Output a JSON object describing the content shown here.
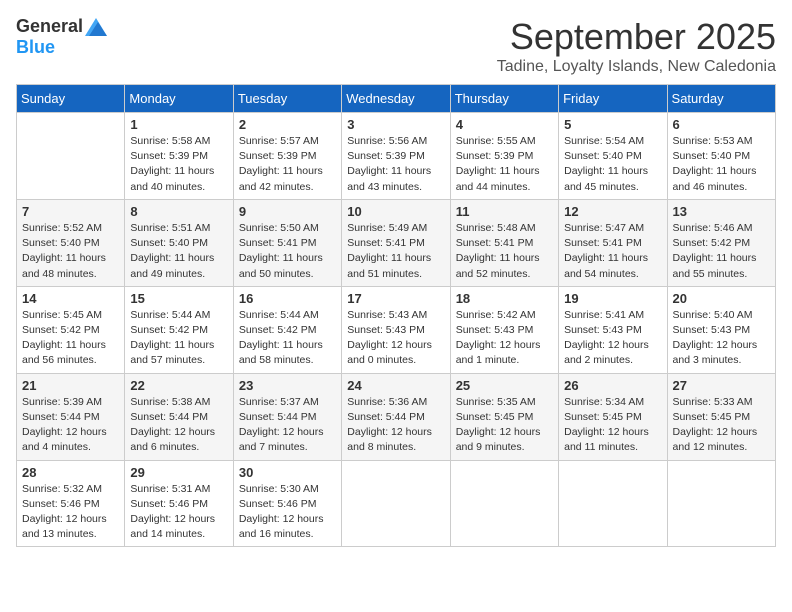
{
  "logo": {
    "general": "General",
    "blue": "Blue"
  },
  "header": {
    "month": "September 2025",
    "location": "Tadine, Loyalty Islands, New Caledonia"
  },
  "weekdays": [
    "Sunday",
    "Monday",
    "Tuesday",
    "Wednesday",
    "Thursday",
    "Friday",
    "Saturday"
  ],
  "weeks": [
    [
      {
        "day": "",
        "sunrise": "",
        "sunset": "",
        "daylight": ""
      },
      {
        "day": "1",
        "sunrise": "Sunrise: 5:58 AM",
        "sunset": "Sunset: 5:39 PM",
        "daylight": "Daylight: 11 hours and 40 minutes."
      },
      {
        "day": "2",
        "sunrise": "Sunrise: 5:57 AM",
        "sunset": "Sunset: 5:39 PM",
        "daylight": "Daylight: 11 hours and 42 minutes."
      },
      {
        "day": "3",
        "sunrise": "Sunrise: 5:56 AM",
        "sunset": "Sunset: 5:39 PM",
        "daylight": "Daylight: 11 hours and 43 minutes."
      },
      {
        "day": "4",
        "sunrise": "Sunrise: 5:55 AM",
        "sunset": "Sunset: 5:39 PM",
        "daylight": "Daylight: 11 hours and 44 minutes."
      },
      {
        "day": "5",
        "sunrise": "Sunrise: 5:54 AM",
        "sunset": "Sunset: 5:40 PM",
        "daylight": "Daylight: 11 hours and 45 minutes."
      },
      {
        "day": "6",
        "sunrise": "Sunrise: 5:53 AM",
        "sunset": "Sunset: 5:40 PM",
        "daylight": "Daylight: 11 hours and 46 minutes."
      }
    ],
    [
      {
        "day": "7",
        "sunrise": "Sunrise: 5:52 AM",
        "sunset": "Sunset: 5:40 PM",
        "daylight": "Daylight: 11 hours and 48 minutes."
      },
      {
        "day": "8",
        "sunrise": "Sunrise: 5:51 AM",
        "sunset": "Sunset: 5:40 PM",
        "daylight": "Daylight: 11 hours and 49 minutes."
      },
      {
        "day": "9",
        "sunrise": "Sunrise: 5:50 AM",
        "sunset": "Sunset: 5:41 PM",
        "daylight": "Daylight: 11 hours and 50 minutes."
      },
      {
        "day": "10",
        "sunrise": "Sunrise: 5:49 AM",
        "sunset": "Sunset: 5:41 PM",
        "daylight": "Daylight: 11 hours and 51 minutes."
      },
      {
        "day": "11",
        "sunrise": "Sunrise: 5:48 AM",
        "sunset": "Sunset: 5:41 PM",
        "daylight": "Daylight: 11 hours and 52 minutes."
      },
      {
        "day": "12",
        "sunrise": "Sunrise: 5:47 AM",
        "sunset": "Sunset: 5:41 PM",
        "daylight": "Daylight: 11 hours and 54 minutes."
      },
      {
        "day": "13",
        "sunrise": "Sunrise: 5:46 AM",
        "sunset": "Sunset: 5:42 PM",
        "daylight": "Daylight: 11 hours and 55 minutes."
      }
    ],
    [
      {
        "day": "14",
        "sunrise": "Sunrise: 5:45 AM",
        "sunset": "Sunset: 5:42 PM",
        "daylight": "Daylight: 11 hours and 56 minutes."
      },
      {
        "day": "15",
        "sunrise": "Sunrise: 5:44 AM",
        "sunset": "Sunset: 5:42 PM",
        "daylight": "Daylight: 11 hours and 57 minutes."
      },
      {
        "day": "16",
        "sunrise": "Sunrise: 5:44 AM",
        "sunset": "Sunset: 5:42 PM",
        "daylight": "Daylight: 11 hours and 58 minutes."
      },
      {
        "day": "17",
        "sunrise": "Sunrise: 5:43 AM",
        "sunset": "Sunset: 5:43 PM",
        "daylight": "Daylight: 12 hours and 0 minutes."
      },
      {
        "day": "18",
        "sunrise": "Sunrise: 5:42 AM",
        "sunset": "Sunset: 5:43 PM",
        "daylight": "Daylight: 12 hours and 1 minute."
      },
      {
        "day": "19",
        "sunrise": "Sunrise: 5:41 AM",
        "sunset": "Sunset: 5:43 PM",
        "daylight": "Daylight: 12 hours and 2 minutes."
      },
      {
        "day": "20",
        "sunrise": "Sunrise: 5:40 AM",
        "sunset": "Sunset: 5:43 PM",
        "daylight": "Daylight: 12 hours and 3 minutes."
      }
    ],
    [
      {
        "day": "21",
        "sunrise": "Sunrise: 5:39 AM",
        "sunset": "Sunset: 5:44 PM",
        "daylight": "Daylight: 12 hours and 4 minutes."
      },
      {
        "day": "22",
        "sunrise": "Sunrise: 5:38 AM",
        "sunset": "Sunset: 5:44 PM",
        "daylight": "Daylight: 12 hours and 6 minutes."
      },
      {
        "day": "23",
        "sunrise": "Sunrise: 5:37 AM",
        "sunset": "Sunset: 5:44 PM",
        "daylight": "Daylight: 12 hours and 7 minutes."
      },
      {
        "day": "24",
        "sunrise": "Sunrise: 5:36 AM",
        "sunset": "Sunset: 5:44 PM",
        "daylight": "Daylight: 12 hours and 8 minutes."
      },
      {
        "day": "25",
        "sunrise": "Sunrise: 5:35 AM",
        "sunset": "Sunset: 5:45 PM",
        "daylight": "Daylight: 12 hours and 9 minutes."
      },
      {
        "day": "26",
        "sunrise": "Sunrise: 5:34 AM",
        "sunset": "Sunset: 5:45 PM",
        "daylight": "Daylight: 12 hours and 11 minutes."
      },
      {
        "day": "27",
        "sunrise": "Sunrise: 5:33 AM",
        "sunset": "Sunset: 5:45 PM",
        "daylight": "Daylight: 12 hours and 12 minutes."
      }
    ],
    [
      {
        "day": "28",
        "sunrise": "Sunrise: 5:32 AM",
        "sunset": "Sunset: 5:46 PM",
        "daylight": "Daylight: 12 hours and 13 minutes."
      },
      {
        "day": "29",
        "sunrise": "Sunrise: 5:31 AM",
        "sunset": "Sunset: 5:46 PM",
        "daylight": "Daylight: 12 hours and 14 minutes."
      },
      {
        "day": "30",
        "sunrise": "Sunrise: 5:30 AM",
        "sunset": "Sunset: 5:46 PM",
        "daylight": "Daylight: 12 hours and 16 minutes."
      },
      {
        "day": "",
        "sunrise": "",
        "sunset": "",
        "daylight": ""
      },
      {
        "day": "",
        "sunrise": "",
        "sunset": "",
        "daylight": ""
      },
      {
        "day": "",
        "sunrise": "",
        "sunset": "",
        "daylight": ""
      },
      {
        "day": "",
        "sunrise": "",
        "sunset": "",
        "daylight": ""
      }
    ]
  ]
}
